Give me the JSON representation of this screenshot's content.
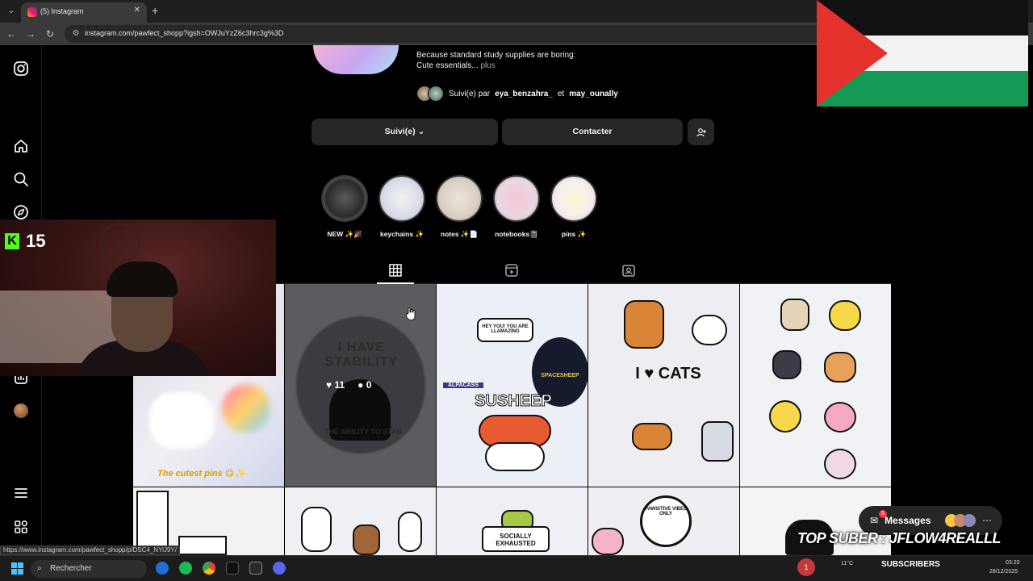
{
  "browser": {
    "tab_title": "(5) Instagram",
    "url": "instagram.com/pawfect_shopp?igsh=OWJuYzZ6c3hrc3g%3D",
    "status_url": "https://www.instagram.com/pawfect_shopp/p/DSC4_NYiJ9Y/"
  },
  "stream": {
    "kick_viewers": "15",
    "banner": "TOP SUBER : JFLOW4REALLL",
    "subscribers_label": "SUBSCRIBERS"
  },
  "profile": {
    "bio_line1": "Because standard study supplies are boring:",
    "bio_line2": "Cute essentials...",
    "bio_more": "plus",
    "followed_prefix": "Suivi(e) par",
    "followed_user1": "eya_benzahra_",
    "followed_and": "et",
    "followed_user2": "may_ounally",
    "follow_button": "Suivi(e)",
    "contact_button": "Contacter"
  },
  "highlights": [
    {
      "label": "NEW ✨🎉"
    },
    {
      "label": "keychains ✨"
    },
    {
      "label": "notes ✨📄"
    },
    {
      "label": "notebooks📓"
    },
    {
      "label": "pins ✨"
    }
  ],
  "posts": {
    "hover_likes": "11",
    "hover_comments": "0",
    "caption_pins": "The cutest pins 😋✨",
    "sticker_stability": "I HAVE STABILITY",
    "sticker_ability": "THE ABILITY TO STAB",
    "sticker_susheep": "SUSHEEP",
    "sticker_spacesheep": "SPACESHEEP",
    "sticker_heyyou": "HEY YOU! YOU ARE LLAMAZING",
    "sticker_alpacass": "ALPACASS",
    "sticker_icats": "I ♥ CATS",
    "sticker_pawsitive": "PAWSITIVE VIBES ONLY",
    "sticker_socially": "SOCIALLY EXHAUSTED"
  },
  "messages": {
    "label": "Messages",
    "badge": "5"
  },
  "taskbar": {
    "search_placeholder": "Rechercher",
    "weather": "11°C",
    "time": "03:20",
    "date": "28/12/2025",
    "notif": "1"
  },
  "colors": {
    "ig_bg": "#000000",
    "button_bg": "#262626",
    "kick_green": "#53fc18",
    "flag_red": "#e4312b",
    "flag_green": "#149954"
  }
}
